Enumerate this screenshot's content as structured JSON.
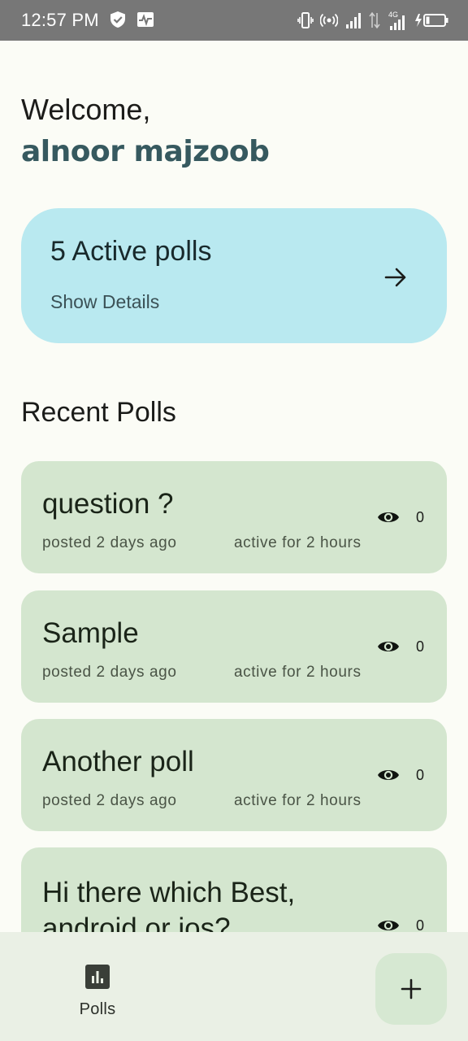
{
  "status_bar": {
    "time": "12:57 PM",
    "network": "4G"
  },
  "header": {
    "welcome": "Welcome,",
    "user_name": "alnoor majzoob"
  },
  "active_card": {
    "title": "5 Active polls",
    "subtitle": "Show Details"
  },
  "recent": {
    "title": "Recent Polls",
    "polls": [
      {
        "question": "question ?",
        "posted": "posted 2 days ago",
        "active": "active for 2 hours",
        "views": "0"
      },
      {
        "question": "Sample",
        "posted": "posted 2 days ago",
        "active": "active for 2 hours",
        "views": "0"
      },
      {
        "question": "Another poll",
        "posted": "posted 2 days ago",
        "active": "active for 2 hours",
        "views": "0"
      },
      {
        "question": "Hi there which Best, android or ios?",
        "posted": "",
        "active": "",
        "views": "0"
      }
    ]
  },
  "bottom_nav": {
    "polls_label": "Polls"
  },
  "icons": {
    "arrow": "arrow-right-icon",
    "eye": "eye-icon",
    "polls": "bar-chart-icon",
    "add": "plus-icon"
  },
  "colors": {
    "active_card_bg": "#b9e9f0",
    "poll_card_bg": "#d4e6cf",
    "user_name": "#36595f",
    "bottom_nav_bg": "#eaf0e5"
  }
}
